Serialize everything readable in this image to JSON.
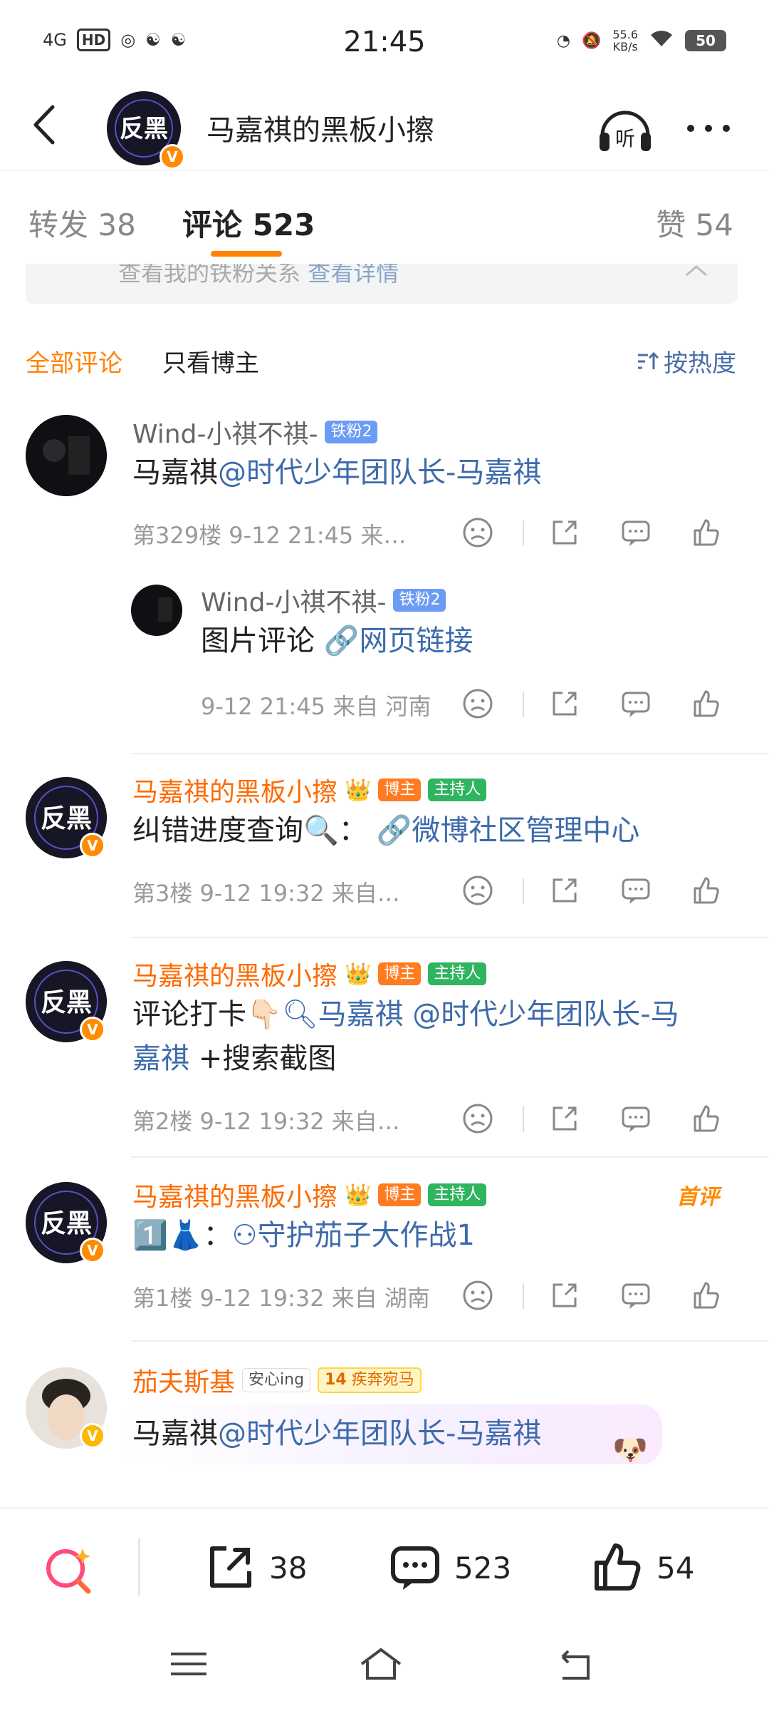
{
  "status_bar": {
    "network": "4G",
    "hd": "HD",
    "time": "21:45",
    "speed_value": "55.6",
    "speed_unit": "KB/s",
    "battery": "50"
  },
  "header": {
    "title": "马嘉祺的黑板小擦",
    "avatar_text": "反黑",
    "listen_label": "听"
  },
  "tabs": [
    {
      "label": "转发 38"
    },
    {
      "label": "评论 523"
    },
    {
      "label": "赞 54"
    }
  ],
  "fan_banner": {
    "text": "查看我的铁粉关系",
    "link": "查看详情"
  },
  "filter": {
    "all": "全部评论",
    "owner_only": "只看博主",
    "sort": "按热度"
  },
  "comments": [
    {
      "name": "Wind-小祺不祺-",
      "fan_badge": "铁粉2",
      "text_prefix": "马嘉祺",
      "mention": "@时代少年团队长-马嘉祺",
      "meta": "第329楼 9-12 21:45 来…",
      "reply": {
        "name": "Wind-小祺不祺-",
        "fan_badge": "铁粉2",
        "text": "图片评论",
        "link": "网页链接",
        "meta": "9-12 21:45 来自 河南"
      }
    },
    {
      "name": "马嘉祺的黑板小擦",
      "host_badge": "博主",
      "mc_badge": "主持人",
      "text": "纠错进度查询🔍：",
      "link": "微博社区管理中心",
      "meta": "第3楼 9-12 19:32 来自…"
    },
    {
      "name": "马嘉祺的黑板小擦",
      "host_badge": "博主",
      "mc_badge": "主持人",
      "text_prefix": "评论打卡👇🏻",
      "search_link": "马嘉祺",
      "mention": " @时代少年团队长-马",
      "line2_mention": "嘉祺",
      "line2_text": " +搜索截图",
      "meta": "第2楼 9-12 19:32 来自…"
    },
    {
      "name": "马嘉祺的黑板小擦",
      "host_badge": "博主",
      "mc_badge": "主持人",
      "first_label": "首评",
      "text_prefix": "1️⃣👗：",
      "link": "守护茄子大作战1",
      "meta": "第1楼 9-12 19:32 来自 湖南"
    },
    {
      "name": "茄夫斯基",
      "safe_badge": "安心ing",
      "run_badge": "疾奔宛马",
      "run_level": "14",
      "text_prefix": "马嘉祺",
      "mention": "@时代少年团队长-马嘉祺"
    }
  ],
  "bottom_bar": {
    "repost": "38",
    "comment": "523",
    "like": "54"
  }
}
